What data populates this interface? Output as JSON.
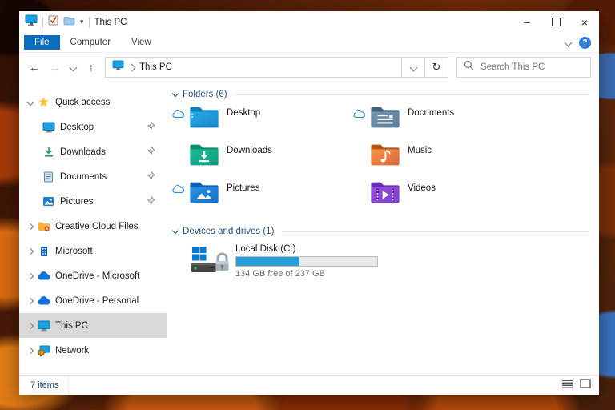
{
  "titlebar": {
    "title": "This PC",
    "icons": {
      "minimize": "–",
      "close": "×",
      "qat_caret": "▾"
    }
  },
  "ribbon": {
    "tabs": [
      {
        "label": "File"
      },
      {
        "label": "Computer"
      },
      {
        "label": "View"
      }
    ],
    "help_glyph": "?"
  },
  "navbar": {
    "icons": {
      "back": "←",
      "forward": "→",
      "up": "↑",
      "refresh": "↻"
    },
    "address": "This PC",
    "search_placeholder": "Search This PC"
  },
  "sidebar": {
    "items": [
      {
        "label": "Quick access"
      },
      {
        "label": "Desktop",
        "pinned": true
      },
      {
        "label": "Downloads",
        "pinned": true
      },
      {
        "label": "Documents",
        "pinned": true
      },
      {
        "label": "Pictures",
        "pinned": true
      },
      {
        "label": "Creative Cloud Files"
      },
      {
        "label": "Microsoft"
      },
      {
        "label": "OneDrive - Microsoft"
      },
      {
        "label": "OneDrive - Personal"
      },
      {
        "label": "This PC",
        "selected": true
      },
      {
        "label": "Network"
      }
    ]
  },
  "content": {
    "groups": [
      {
        "label": "Folders (6)"
      },
      {
        "label": "Devices and drives (1)"
      }
    ],
    "folders": [
      {
        "label": "Desktop",
        "cloud": true
      },
      {
        "label": "Documents",
        "cloud": true
      },
      {
        "label": "Downloads"
      },
      {
        "label": "Music"
      },
      {
        "label": "Pictures",
        "cloud": true
      },
      {
        "label": "Videos"
      }
    ],
    "drive": {
      "label": "Local Disk (C:)",
      "free_text": "134 GB free of 237 GB",
      "used_percent": 45,
      "bar_style": "width:45%"
    }
  },
  "statusbar": {
    "items_count": "7 items"
  },
  "colors": {
    "accent": "#0b6dbd",
    "bar_fill": "#26a0da",
    "selection": "#d9d9d9"
  }
}
